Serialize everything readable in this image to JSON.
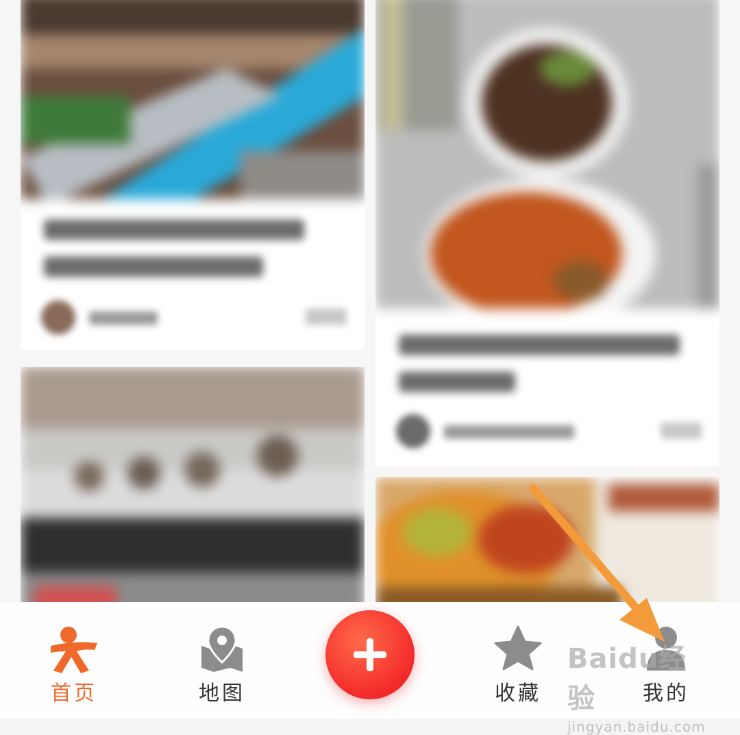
{
  "bottom_nav": {
    "tabs": [
      {
        "label": "首页",
        "icon": "person-logo-icon",
        "active": true
      },
      {
        "label": "地图",
        "icon": "map-pin-icon",
        "active": false
      },
      {
        "label": "收藏",
        "icon": "star-icon",
        "active": false
      },
      {
        "label": "我的",
        "icon": "user-icon",
        "active": false
      }
    ],
    "add_button_icon": "plus-icon"
  },
  "watermark": {
    "brand": "Baidu经验",
    "url": "jingyan.baidu.com"
  },
  "colors": {
    "accent": "#ef6a2a",
    "fab": "#f32a2a",
    "arrow": "#f39a3a"
  }
}
